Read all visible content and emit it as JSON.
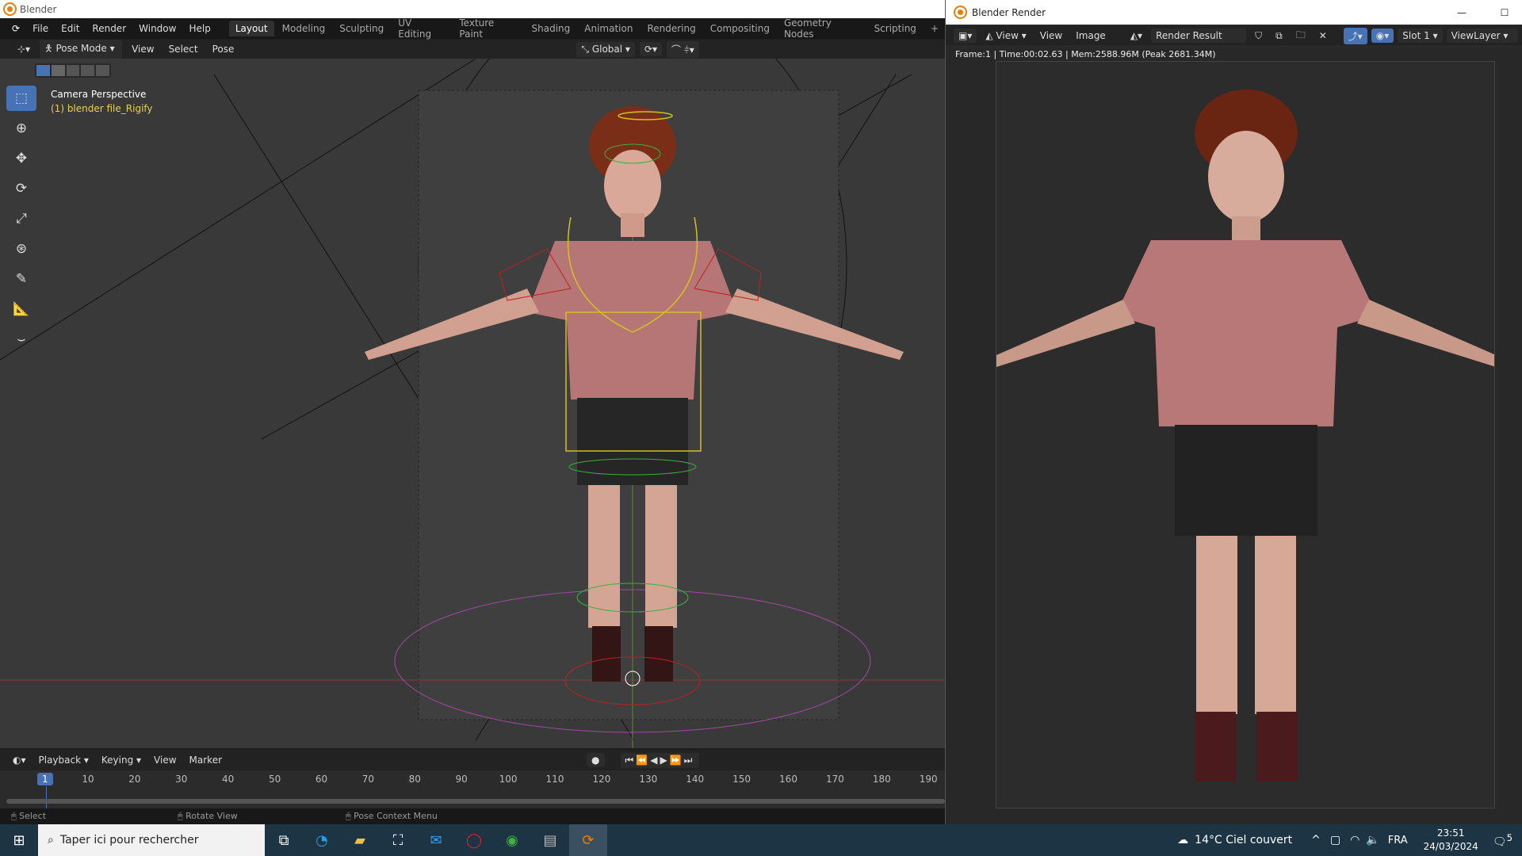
{
  "main_window": {
    "title": "Blender",
    "menu": [
      "File",
      "Edit",
      "Render",
      "Window",
      "Help"
    ],
    "workspaces": [
      "Layout",
      "Modeling",
      "Sculpting",
      "UV Editing",
      "Texture Paint",
      "Shading",
      "Animation",
      "Rendering",
      "Compositing",
      "Geometry Nodes",
      "Scripting",
      "+"
    ],
    "header": {
      "mode": "Pose Mode",
      "menus": [
        "View",
        "Select",
        "Pose"
      ],
      "orientation": "Global"
    },
    "viewport": {
      "camera_label": "Camera Perspective",
      "object_label": "(1) blender file_Rigify"
    },
    "timeline": {
      "menus": [
        "Playback",
        "Keying",
        "View",
        "Marker"
      ],
      "current_frame": "1",
      "frame_labels": [
        "10",
        "20",
        "30",
        "40",
        "50",
        "60",
        "70",
        "80",
        "90",
        "100",
        "110",
        "120",
        "130",
        "140",
        "150",
        "160",
        "170",
        "180",
        "190"
      ]
    },
    "status_bar": [
      "Select",
      "Rotate View",
      "Pose Context Menu"
    ]
  },
  "render_window": {
    "title": "Blender Render",
    "menus": [
      "View",
      "View",
      "Image"
    ],
    "image_name": "Render Result",
    "slot": "Slot 1",
    "view_layer": "ViewLayer",
    "info": "Frame:1 | Time:00:02.63 | Mem:2588.96M (Peak 2681.34M)"
  },
  "taskbar": {
    "search_placeholder": "Taper ici pour rechercher",
    "weather": "14°C  Ciel couvert",
    "language": "FRA",
    "time": "23:51",
    "date": "24/03/2024",
    "notifications": "5"
  },
  "colors": {
    "accent": "#4772b3",
    "taskbar": "#1c3444",
    "blender_orange": "#e87d0d"
  }
}
